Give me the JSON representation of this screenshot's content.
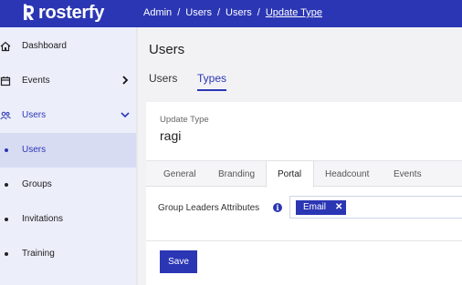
{
  "app": {
    "brand": "rosterfy"
  },
  "breadcrumb": {
    "items": [
      "Admin",
      "Users",
      "Users"
    ],
    "current": "Update Type",
    "separator": "/"
  },
  "sidebar": {
    "items": [
      {
        "label": "Dashboard",
        "icon": "home-icon"
      },
      {
        "label": "Events",
        "icon": "calendar-icon"
      },
      {
        "label": "Users",
        "icon": "users-icon"
      },
      {
        "label": "Users"
      },
      {
        "label": "Groups"
      },
      {
        "label": "Invitations"
      },
      {
        "label": "Training"
      }
    ]
  },
  "page": {
    "title": "Users"
  },
  "tabs": [
    {
      "label": "Users"
    },
    {
      "label": "Types"
    }
  ],
  "card": {
    "field_label": "Update Type",
    "name": "ragi",
    "subtabs": [
      "General",
      "Branding",
      "Portal",
      "Headcount",
      "Events"
    ],
    "active_subtab": "Portal",
    "group_leaders": {
      "label": "Group Leaders Attributes",
      "tags": [
        "Email"
      ]
    },
    "save_label": "Save"
  },
  "colors": {
    "brand": "#2b36b4",
    "sidebar_bg": "#eceefa",
    "active_bg": "#d8dcf3"
  }
}
